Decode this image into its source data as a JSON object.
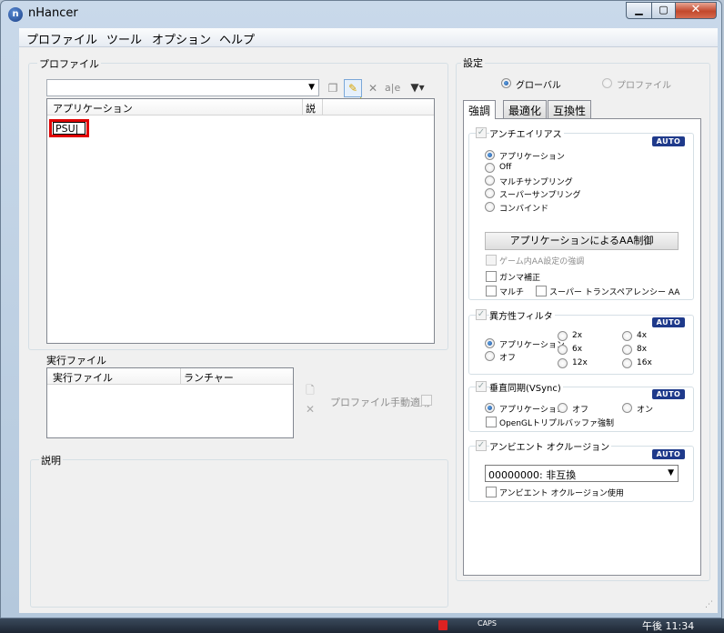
{
  "window": {
    "title": "nHancer"
  },
  "menubar": [
    "プロファイル",
    "ツール",
    "オプション",
    "ヘルプ"
  ],
  "profile_group": {
    "label": "プロファイル",
    "list_headers": {
      "application": "アプリケーション",
      "desc": "説"
    },
    "editing_value": "PSU"
  },
  "exec_group": {
    "label": "実行ファイル",
    "headers": {
      "exec": "実行ファイル",
      "launcher": "ランチャー"
    },
    "manual_apply": "プロファイル手動適用"
  },
  "desc_group": {
    "label": "説明"
  },
  "settings": {
    "label": "設定",
    "scope": {
      "global": "グローバル",
      "profile": "プロファイル"
    },
    "tabs": [
      "強調",
      "最適化",
      "互換性"
    ],
    "antialias": {
      "title": "アンチエイリアス",
      "options": [
        "アプリケーション",
        "Off",
        "マルチサンプリング",
        "スーパーサンプリング",
        "コンバインド"
      ],
      "app_button": "アプリケーションによるAA制御",
      "ingame": "ゲーム内AA設定の強調",
      "gamma": "ガンマ補正",
      "multi": "マルチ",
      "super_transp": "スーパー トランスペアレンシー AA"
    },
    "aniso": {
      "title": "異方性フィルタ",
      "app": "アプリケーション",
      "off": "オフ",
      "levels": [
        "2x",
        "4x",
        "6x",
        "8x",
        "12x",
        "16x"
      ]
    },
    "vsync": {
      "title": "垂直同期(VSync)",
      "app": "アプリケーション",
      "off": "オフ",
      "on": "オン",
      "triple": "OpenGLトリプルバッファ強制"
    },
    "ao": {
      "title": "アンビエント オクルージョン",
      "value": "00000000: 非互換",
      "use": "アンビエント オクルージョン使用"
    },
    "auto_label": "AUTO"
  },
  "taskbar": {
    "caps": "CAPS",
    "clock": "午後 11:34"
  }
}
